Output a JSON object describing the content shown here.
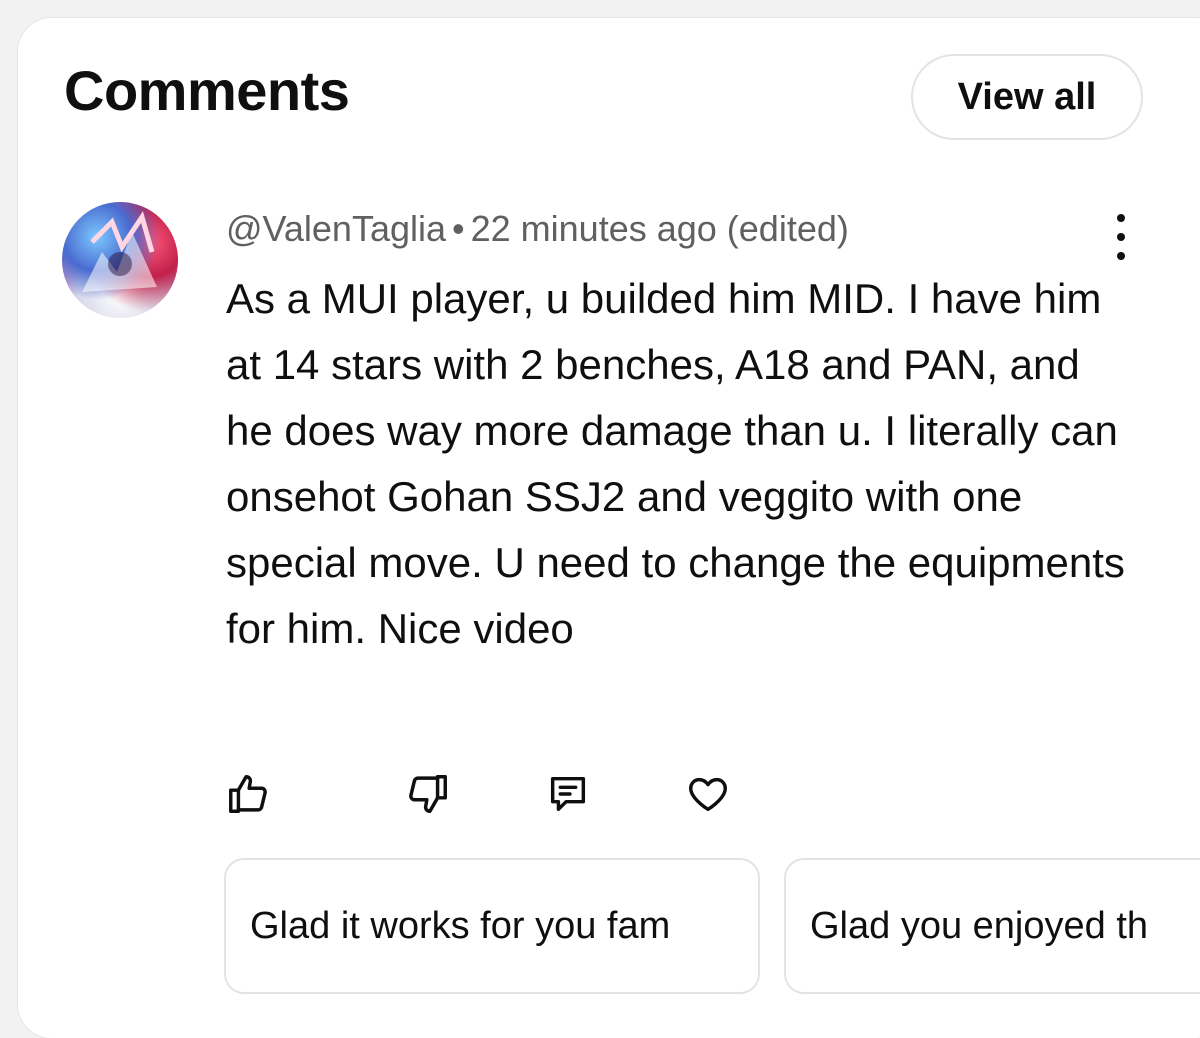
{
  "header": {
    "title": "Comments",
    "view_all_label": "View all"
  },
  "comment": {
    "author": "@ValenTaglia",
    "separator": "•",
    "time": "22 minutes ago (edited)",
    "text": "As a MUI player, u builded him MID. I have him at 14 stars with 2 benches, A18 and PAN, and he does way more damage than u. I literally can onsehot Gohan SSJ2 and veggito with one special move. U need to change the equipments for him. Nice video",
    "actions": [
      {
        "icon": "thumbs-up-icon"
      },
      {
        "icon": "thumbs-down-icon"
      },
      {
        "icon": "reply-icon"
      },
      {
        "icon": "heart-icon"
      }
    ]
  },
  "suggested_replies": [
    {
      "label": "Glad it works for you fam"
    },
    {
      "label": "Glad you enjoyed th"
    }
  ]
}
